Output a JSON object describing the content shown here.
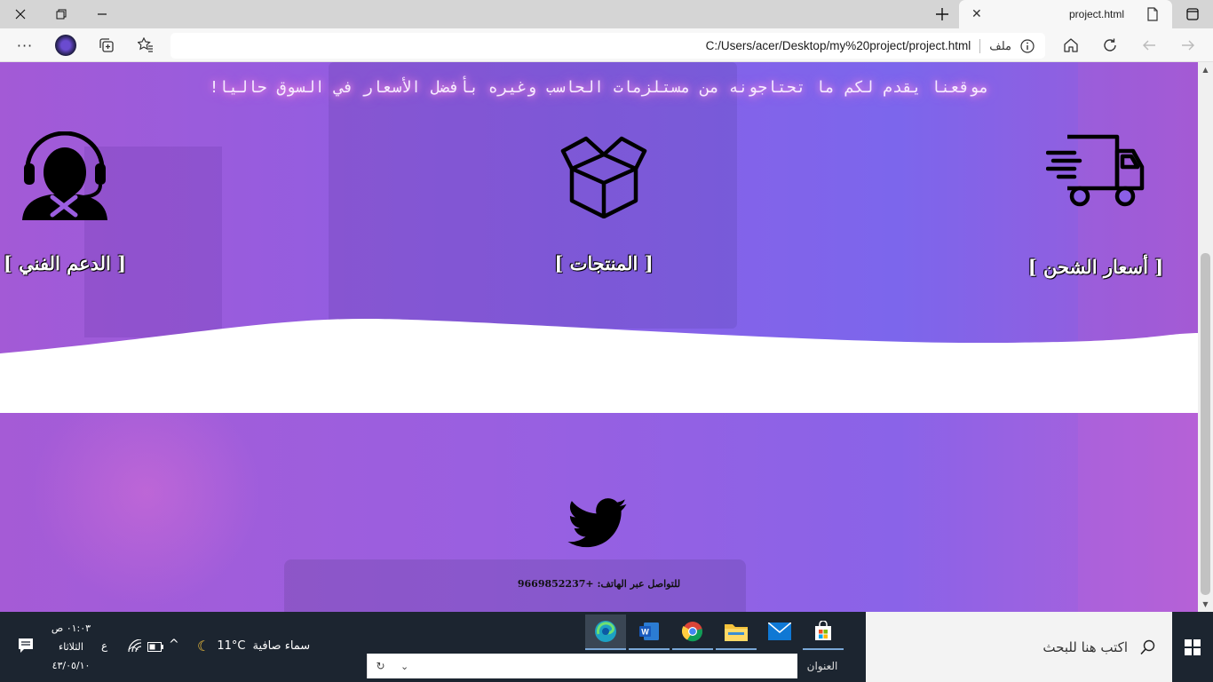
{
  "browser": {
    "tab_title": "project.html",
    "address_url": "C:/Users/acer/Desktop/my%20project/project.html",
    "address_label": "ملف"
  },
  "page": {
    "tagline": "موقعنا يقدم لكم ما تحتاجونه من مستلزمات الحاسب وغيره بأفضل الأسعار في السوق حاليا!",
    "features": [
      {
        "label": "[ أسعار الشحن ]",
        "icon": "delivery-truck-icon"
      },
      {
        "label": "[ المنتجات ]",
        "icon": "open-box-icon"
      },
      {
        "label": "[ الدعم الفني ]",
        "icon": "support-agent-icon"
      }
    ],
    "footer": {
      "social_icon": "twitter-icon",
      "phone_text": "للتواصل عبر الهاتف: +9669852237"
    }
  },
  "taskbar": {
    "search_placeholder": "اكتب هنا للبحث",
    "address_toolbar_label": "العنوان",
    "weather_text": "سماء صافية",
    "temperature": "11°C",
    "lang": "ع",
    "time": "٠١:٠٣ ص",
    "day": "الثلاثاء",
    "date": "٤٣/٠٥/١٠"
  },
  "colors": {
    "hero_purple": "#8b5fe6",
    "footer_purple": "#9a5fe0",
    "taskbar": "#1c2530"
  }
}
